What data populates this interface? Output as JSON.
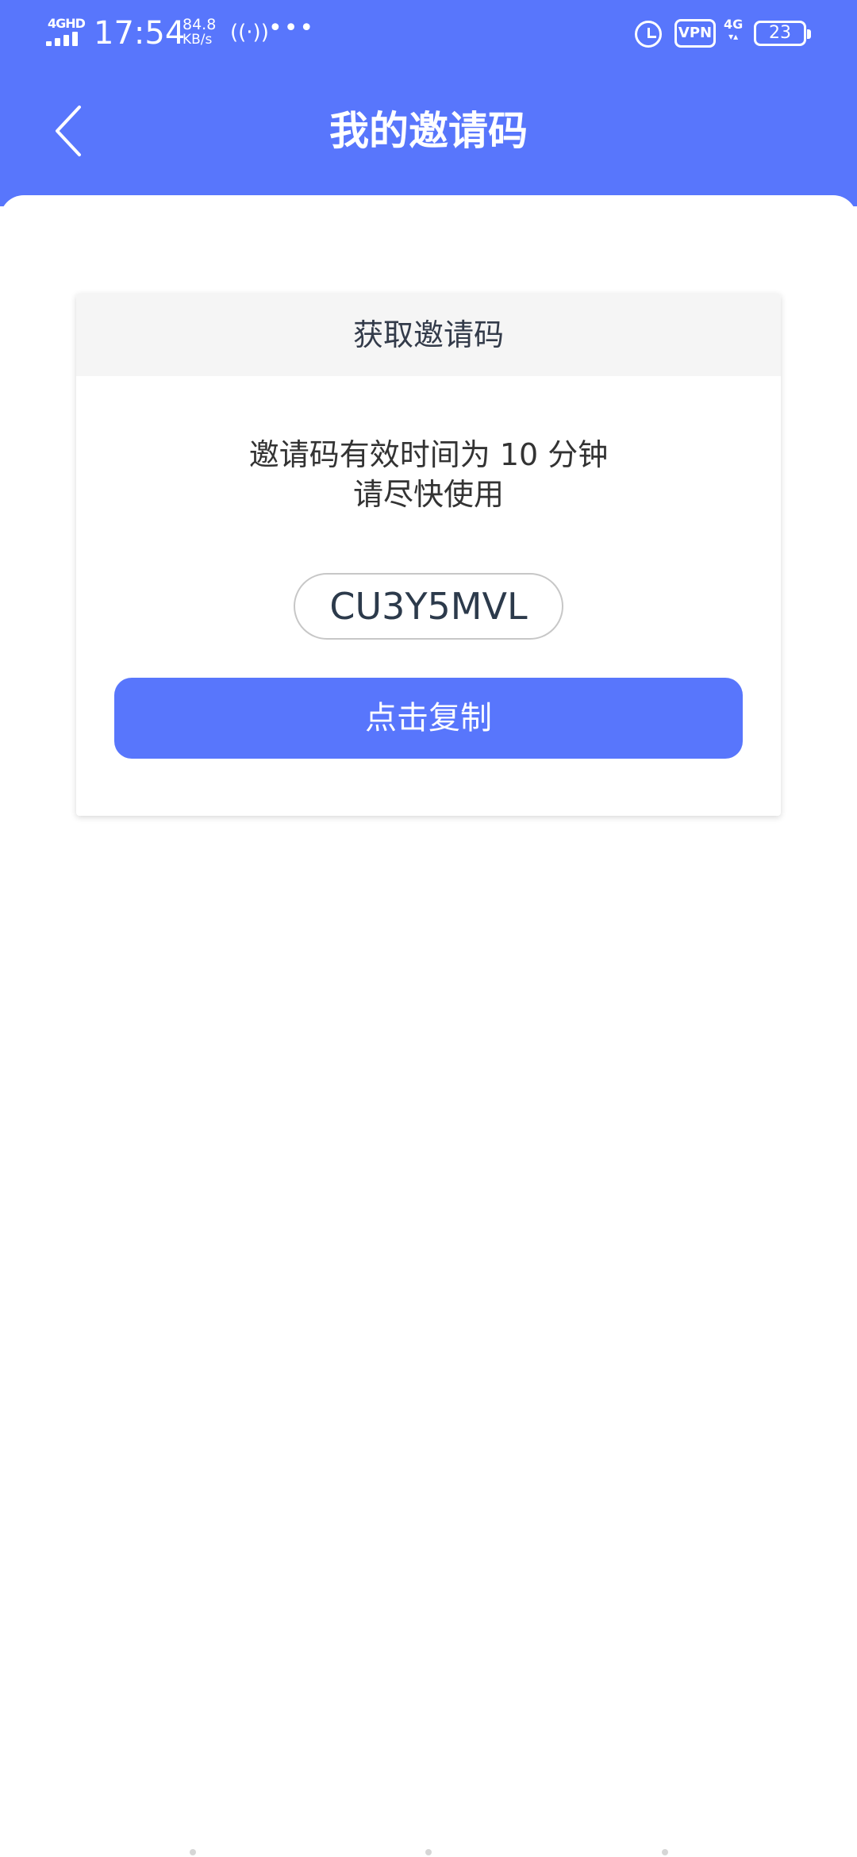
{
  "status_bar": {
    "network_tag": "4GHD",
    "time": "17:54",
    "speed_value": "84.8",
    "speed_unit": "KB/s",
    "hotspot": "((·))",
    "more_dots": "•••",
    "vpn": "VPN",
    "cell_4g": "4G",
    "battery": "23"
  },
  "header": {
    "title": "我的邀请码"
  },
  "card": {
    "title": "获取邀请码",
    "notice_line1": "邀请码有效时间为 10 分钟",
    "notice_line2": "请尽快使用",
    "invite_code": "CU3Y5MVL",
    "copy_button": "点击复制"
  },
  "colors": {
    "brand": "#5876fc",
    "card_header_bg": "#f5f5f5"
  }
}
